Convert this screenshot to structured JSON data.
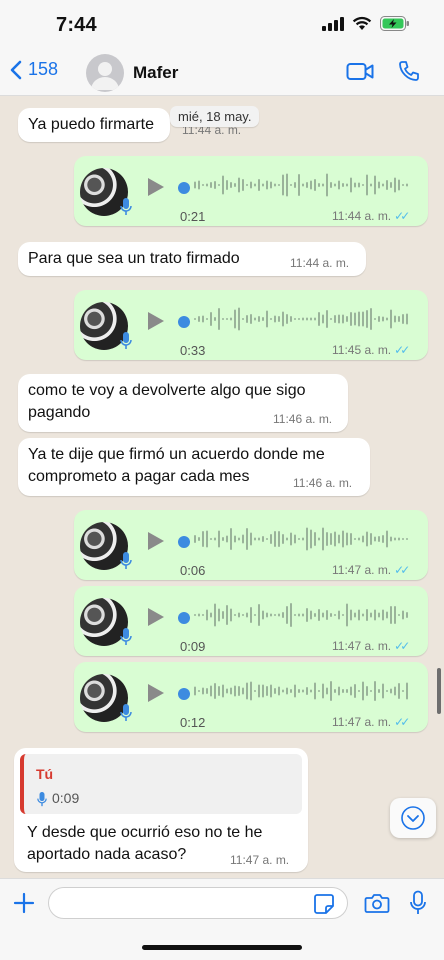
{
  "status_bar": {
    "time": "7:44"
  },
  "header": {
    "back_count": "158",
    "contact_name": "Mafer"
  },
  "date_chip": "mié, 18 may.",
  "messages": [
    {
      "type": "text",
      "direction": "in",
      "text": "Ya puedo firmarte",
      "time": "11:44 a. m."
    },
    {
      "type": "voice",
      "direction": "out",
      "duration": "0:21",
      "time": "11:44 a. m."
    },
    {
      "type": "text",
      "direction": "in",
      "text": "Para que sea un trato firmado",
      "time": "11:44 a. m."
    },
    {
      "type": "voice",
      "direction": "out",
      "duration": "0:33",
      "time": "11:45 a. m."
    },
    {
      "type": "text",
      "direction": "in",
      "text_line1": "como te voy a devolverte algo que sigo",
      "text_line2": "pagando",
      "time": "11:46 a. m."
    },
    {
      "type": "text",
      "direction": "in",
      "text_line1": "Ya te dije que firmó un acuerdo donde me",
      "text_line2": "comprometo a pagar cada mes",
      "time": "11:46 a. m."
    },
    {
      "type": "voice",
      "direction": "out",
      "duration": "0:06",
      "time": "11:47 a. m."
    },
    {
      "type": "voice",
      "direction": "out",
      "duration": "0:09",
      "time": "11:47 a. m."
    },
    {
      "type": "voice",
      "direction": "out",
      "duration": "0:12",
      "time": "11:47 a. m."
    },
    {
      "type": "reply",
      "direction": "in",
      "quote_author": "Tú",
      "quote_duration": "0:09",
      "text_line1": "Y desde que ocurrió eso no te he",
      "text_line2": "aportado nada acaso?",
      "time": "11:47 a. m."
    }
  ],
  "composer": {
    "placeholder": ""
  },
  "colors": {
    "accent": "#1a73e8",
    "outgoing_bubble": "#d9fdd3",
    "incoming_bubble": "#ffffff",
    "read_check": "#53bdeb",
    "reply_author": "#d63a2f"
  },
  "icons": [
    "back-chevron-icon",
    "video-call-icon",
    "phone-icon",
    "play-icon",
    "mic-icon",
    "double-check-icon",
    "chevron-down-icon",
    "plus-icon",
    "sticker-icon",
    "camera-icon",
    "microphone-icon"
  ]
}
